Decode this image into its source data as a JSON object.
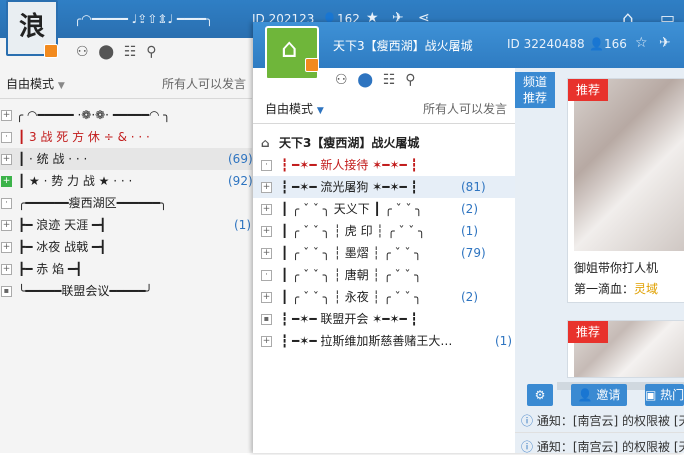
{
  "back_window": {
    "logo_char": "浪",
    "header_deco": "╭◠━━━━━ ♩⇪⇧⇭♩ ━━━━╮",
    "header_deco2": "━━━━╮",
    "channel_id": "ID 202123",
    "user_count": "162",
    "mode_label": "自由模式",
    "speak_rule": "所有人可以发言",
    "rows": [
      {
        "text": "╭ ◠━━━━━ ·❁·❁· ━━━━━◠ ╮",
        "count": ""
      },
      {
        "text": "┃  3  战 死 方 休 ÷ &  · · ·",
        "count": ""
      },
      {
        "text": "┃   ·  统            战   · · ·",
        "count": "(69)"
      },
      {
        "text": "┃  ★ ·  势   力    战   ★ · · ·",
        "count": "(92)"
      },
      {
        "text": "╭━━━━━━瘦西湖区━━━━━━╮",
        "count": ""
      },
      {
        "text": "┣━        浪迹   天涯           ━┫",
        "count": "(1)"
      },
      {
        "text": "┣━        冰夜   战戟           ━┫",
        "count": ""
      },
      {
        "text": "┣━           赤     焰           ━┫",
        "count": ""
      },
      {
        "text": "╰━━━━━联盟会议━━━━━╯",
        "count": ""
      }
    ]
  },
  "front_window": {
    "title": "天下3【瘦西湖】战火屠城",
    "channel_id": "ID 32240488",
    "user_count": "166",
    "mode_label": "自由模式",
    "speak_rule": "所有人可以发言",
    "root_label": "天下3【瘦西湖】战火屠城",
    "rows": [
      {
        "text": "┇ ━✶━        新人接待     ✶━✶━ ┇",
        "count": "",
        "red": true
      },
      {
        "text": "┇ ━✶━        流光屠狗     ✶━✶━ ┇",
        "count": "(81)",
        "red": false
      },
      {
        "text": "┃ ╭ ˇ ˇ ╮  天义下 ┃ ╭ ˇ ˇ ╮",
        "count": "(2)",
        "red": false
      },
      {
        "text": "┃ ╭ ˇ ˇ ╮ ┆ 虎 印 ┆ ╭ ˇ ˇ ╮",
        "count": "(1)",
        "red": false
      },
      {
        "text": "┃ ╭ ˇ ˇ ╮ ┆ 墨熠 ┆ ╭ ˇ ˇ ╮",
        "count": "(79)",
        "red": false
      },
      {
        "text": "┃ ╭ ˇ ˇ ╮ ┆ 唐朝 ┆ ╭ ˇ ˇ ╮",
        "count": "",
        "red": false
      },
      {
        "text": "┃ ╭ ˇ ˇ ╮ ┆ 永夜 ┆ ╭ ˇ ˇ ╮",
        "count": "(2)",
        "red": false
      },
      {
        "text": "┇ ━✶━        联盟开会     ✶━✶━ ┇",
        "count": "",
        "red": false
      },
      {
        "text": "┇ ━✶━        拉斯维加斯慈善赌王大…",
        "count": "(1)",
        "red": false
      }
    ],
    "side": {
      "tab": "频道推荐",
      "card1_tag": "推荐",
      "card1_caption": "御姐带你打人机",
      "card1_sub_label": "第一滴血：",
      "card1_sub_value": "灵域",
      "card2_tag": "推荐",
      "settings_label": "",
      "invite_label": "邀请",
      "hot_label": "热门"
    },
    "notices": [
      "通知：[南宫云] 的权限被 [天",
      "通知：[南宫云] 的权限被 [天"
    ]
  },
  "colors": {
    "header_blue": "#2f7cc2",
    "accent_red": "#e8322c",
    "count_blue": "#2e74c0",
    "logo_green": "#6fb63a"
  }
}
